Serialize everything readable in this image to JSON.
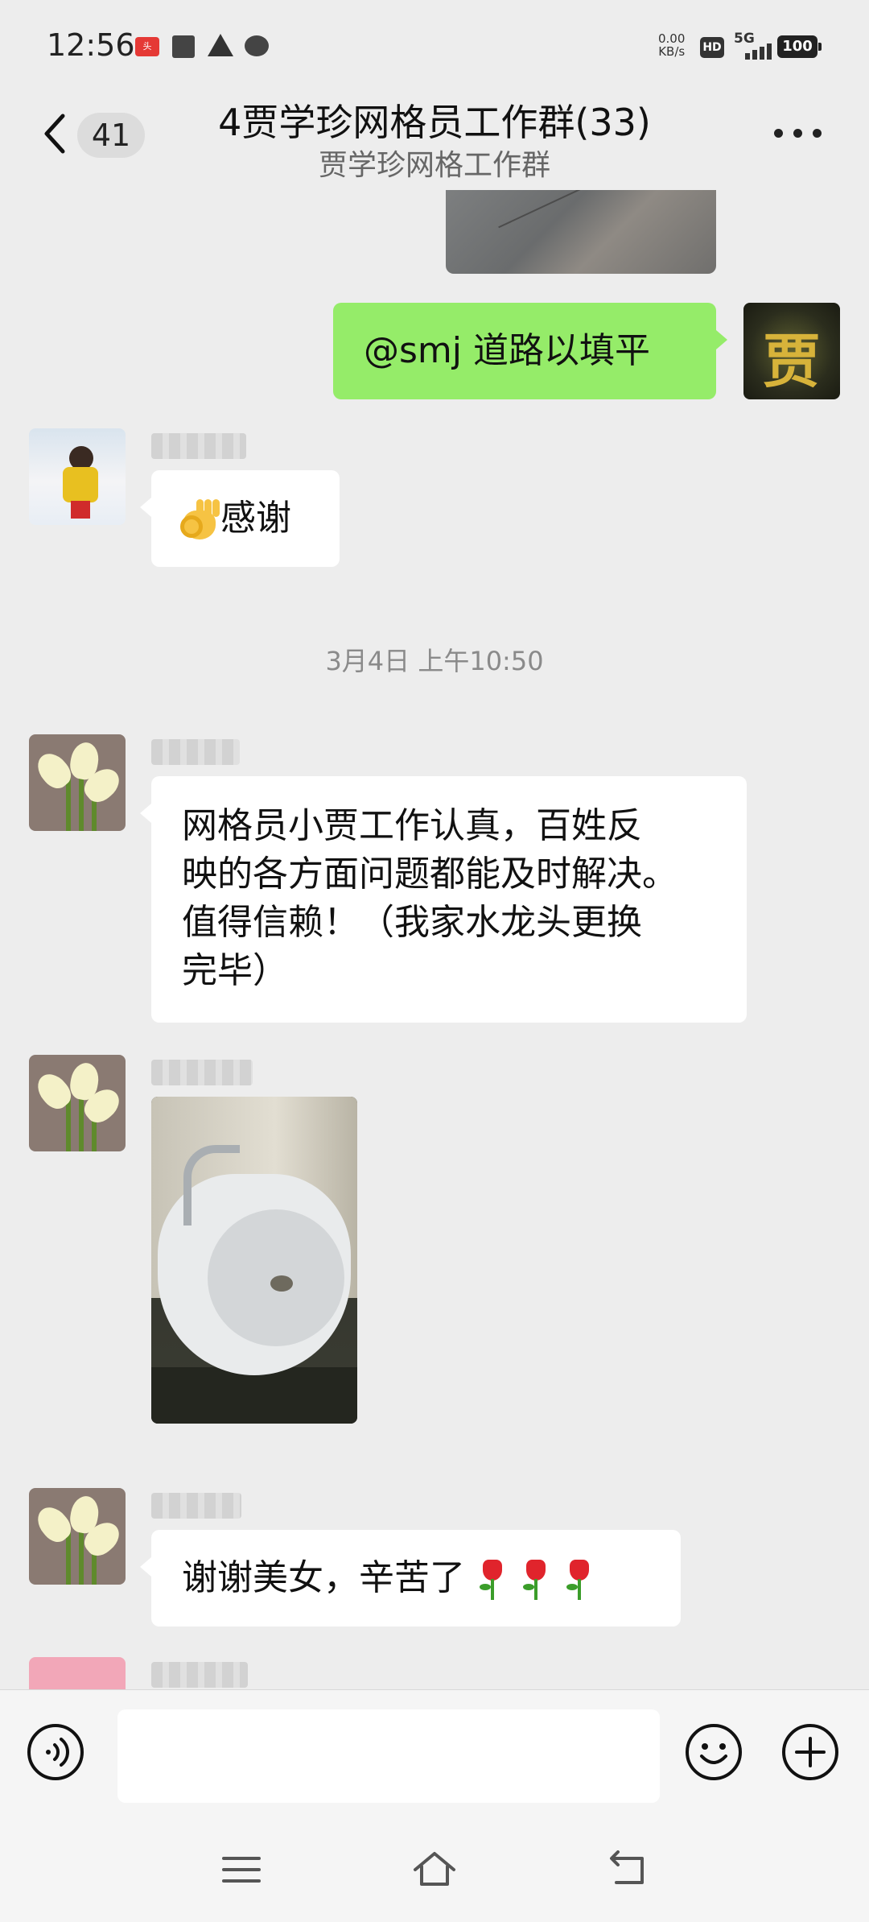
{
  "status_bar": {
    "time": "12:56",
    "speed_value": "0.00",
    "speed_unit": "KB/s",
    "hd": "HD",
    "network": "5G",
    "battery": "100"
  },
  "header": {
    "unread_count": "41",
    "title": "4贾学珍网格员工作群(33)",
    "subtitle": "贾学珍网格工作群"
  },
  "messages": [
    {
      "id": "m1",
      "side": "right",
      "avatar": "gold-glyph-avatar",
      "avatar_char": "贾",
      "text": "@smj  道路以填平"
    },
    {
      "id": "m2",
      "side": "left",
      "avatar": "skiing-child-avatar",
      "emoji": "ok-hand",
      "text": "感谢"
    },
    {
      "id": "m3",
      "side": "left",
      "avatar": "calla-lily-avatar",
      "text_lines": [
        "网格员小贾工作认真，百姓反",
        "映的各方面问题都能及时解决。",
        "值得信赖！（我家水龙头更换",
        "完毕）"
      ]
    },
    {
      "id": "m4",
      "side": "left",
      "avatar": "calla-lily-avatar",
      "type": "image",
      "image": "bathroom-sink-photo"
    },
    {
      "id": "m5",
      "side": "left",
      "avatar": "calla-lily-avatar",
      "text": "谢谢美女，辛苦了",
      "emoji": "tulip",
      "emoji_count": 3
    }
  ],
  "timestamp": "3月4日 上午10:50",
  "input": {
    "placeholder": ""
  },
  "colors": {
    "background": "#ededed",
    "self_bubble": "#95ec69",
    "other_bubble": "#ffffff"
  }
}
